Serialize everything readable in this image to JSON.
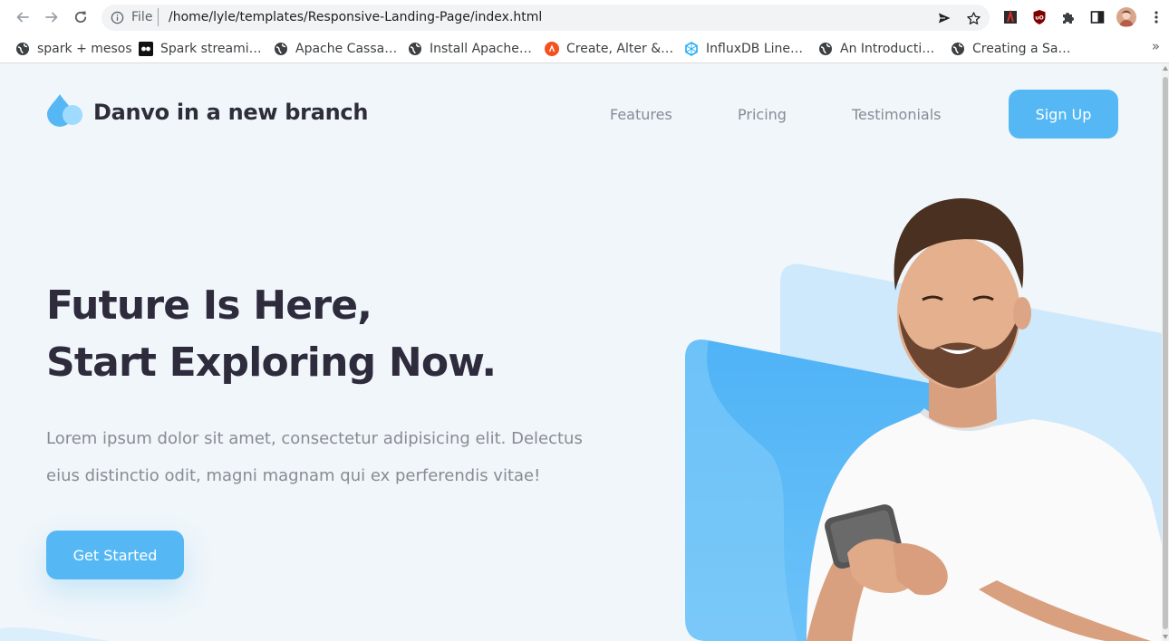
{
  "browser": {
    "url_scheme": "File",
    "url": "/home/lyle/templates/Responsive-Landing-Page/index.html",
    "nav_icons": [
      "back-arrow-icon",
      "forward-arrow-icon",
      "reload-icon"
    ],
    "omnibox_icons": [
      "info-icon",
      "send-icon",
      "star-icon"
    ],
    "extension_icons": [
      "extension-red-icon",
      "ublock-icon",
      "puzzle-icon",
      "sidepanel-icon",
      "profile-avatar",
      "kebab-menu-icon"
    ],
    "bookmarks": [
      {
        "label": "spark + mesos",
        "icon": "globe-icon"
      },
      {
        "label": "Spark streami…",
        "icon": "video-icon"
      },
      {
        "label": "Apache Cassa…",
        "icon": "globe-icon"
      },
      {
        "label": "Install Apache…",
        "icon": "globe-icon"
      },
      {
        "label": "Create, Alter &…",
        "icon": "orange-site-icon"
      },
      {
        "label": "InfluxDB Line…",
        "icon": "influx-icon"
      },
      {
        "label": "An Introducti…",
        "icon": "globe-icon"
      },
      {
        "label": "Creating a Sa…",
        "icon": "globe-icon"
      }
    ],
    "bookmarks_overflow": "»"
  },
  "page": {
    "brand": "Danvo in a new branch",
    "nav": {
      "features": "Features",
      "pricing": "Pricing",
      "testimonials": "Testimonials"
    },
    "signup_label": "Sign Up",
    "headline_line1": "Future Is Here,",
    "headline_line2": "Start Exploring Now.",
    "lede": "Lorem ipsum dolor sit amet, consectetur adipisicing elit. Delectus eius distinctio odit, magni magnam qui ex perferendis vitae!",
    "cta_label": "Get Started"
  },
  "colors": {
    "accent": "#55b8f5",
    "page_bg": "#f0f6fa",
    "heading": "#2e2b3d",
    "muted_text": "#8a8a94"
  }
}
